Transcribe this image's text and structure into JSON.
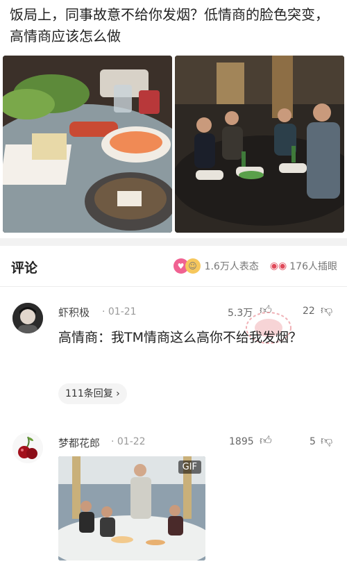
{
  "post": {
    "headline": "饭局上，同事故意不给你发烟？低情商的脸色突变，高情商应该怎么做"
  },
  "comments_section": {
    "title": "评论",
    "reactions_count": "1.6万人表态",
    "stare_count": "176人插眼"
  },
  "comments": [
    {
      "username": "虾积极",
      "date": "· 01-21",
      "likes": "5.3万",
      "dislikes": "22",
      "text": "高情商：我TM情商这么高你不给我发烟？",
      "replies": "111条回复 ›"
    },
    {
      "username": "梦都花郎",
      "date": "· 01-22",
      "likes": "1895",
      "dislikes": "5",
      "attachment_badge": "GIF"
    }
  ],
  "colors": {
    "accent_pink": "#f06292",
    "stamp_red": "#e5707a"
  }
}
